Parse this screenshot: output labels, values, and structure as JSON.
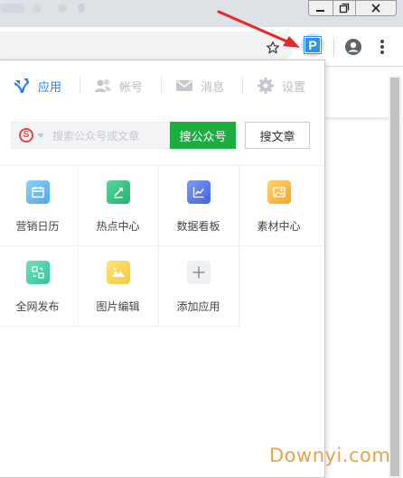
{
  "window": {
    "controls": {
      "minimize_icon": "minimize-icon",
      "maximize_icon": "restore-icon",
      "close_icon": "close-icon"
    }
  },
  "toolbar": {
    "extension_label": "P",
    "extension_color": "#2b95e9",
    "icons": [
      "star-icon",
      "profile-icon",
      "more-icon"
    ]
  },
  "popup": {
    "nav": [
      {
        "label": "应用",
        "icon": "apps-icon",
        "active": true
      },
      {
        "label": "帐号",
        "icon": "account-icon",
        "active": false
      },
      {
        "label": "消息",
        "icon": "message-icon",
        "active": false
      },
      {
        "label": "设置",
        "icon": "settings-icon",
        "active": false
      }
    ],
    "search": {
      "engine_icon": "sogou-icon",
      "placeholder": "搜索公众号或文章",
      "search_accounts_label": "搜公众号",
      "search_articles_label": "搜文章"
    },
    "apps": [
      {
        "label": "营销日历",
        "icon": "calendar-icon"
      },
      {
        "label": "热点中心",
        "icon": "trending-icon"
      },
      {
        "label": "数据看板",
        "icon": "chart-icon"
      },
      {
        "label": "素材中心",
        "icon": "image-icon"
      },
      {
        "label": "全网发布",
        "icon": "publish-icon"
      },
      {
        "label": "图片编辑",
        "icon": "photo-edit-icon"
      },
      {
        "label": "添加应用",
        "icon": "plus-icon"
      }
    ]
  },
  "colors": {
    "accent": "#2d7cf6",
    "primary_button": "#1aad3f",
    "arrow": "#e8262b"
  },
  "watermark": "Downyi.com"
}
